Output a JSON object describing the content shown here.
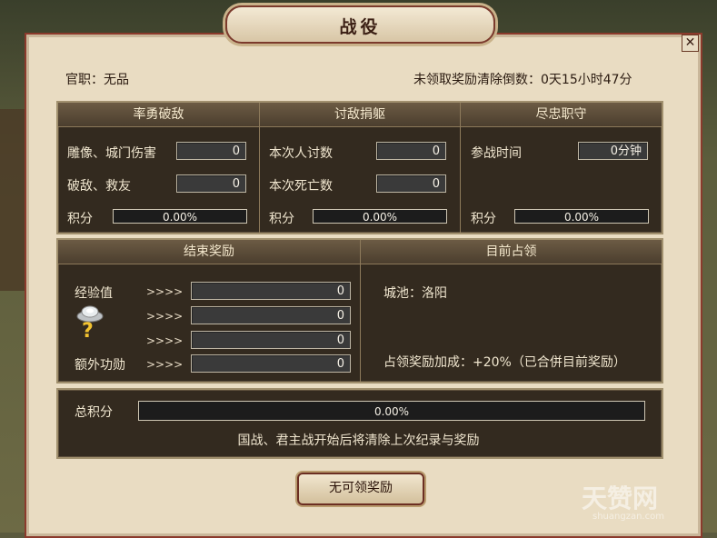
{
  "title": "战役",
  "close_symbol": "✕",
  "official_rank": "官职：无品",
  "countdown": "未领取奖励清除倒数：0天15小时47分",
  "sections": {
    "bravery": {
      "header": "率勇破敌",
      "row1_label": "雕像、城门伤害",
      "row1_value": "0",
      "row2_label": "破敌、救友",
      "row2_value": "0",
      "score_label": "积分",
      "score_value": "0.00%"
    },
    "kills": {
      "header": "讨敌捐躯",
      "row1_label": "本次人讨数",
      "row1_value": "0",
      "row2_label": "本次死亡数",
      "row2_value": "0",
      "score_label": "积分",
      "score_value": "0.00%"
    },
    "loyalty": {
      "header": "尽忠职守",
      "row1_label": "参战时间",
      "row1_value": "0分钟",
      "score_label": "积分",
      "score_value": "0.00%"
    }
  },
  "rewards": {
    "header": "结束奖励",
    "arrow": ">>>>",
    "exp_label": "经验值",
    "exp_value": "0",
    "silver_value": "0",
    "mystery_value": "0",
    "merit_label": "额外功勋",
    "merit_value": "0"
  },
  "occupation": {
    "header": "目前占领",
    "city": "城池：洛阳",
    "bonus": "占领奖励加成：+20%（已合併目前奖励）"
  },
  "total": {
    "label": "总积分",
    "value": "0.00%",
    "note": "国战、君主战开始后将清除上次纪录与奖励"
  },
  "claim_button": "无可领奖励",
  "watermark": "天赞网",
  "watermark_sub": "shuangzan.com"
}
